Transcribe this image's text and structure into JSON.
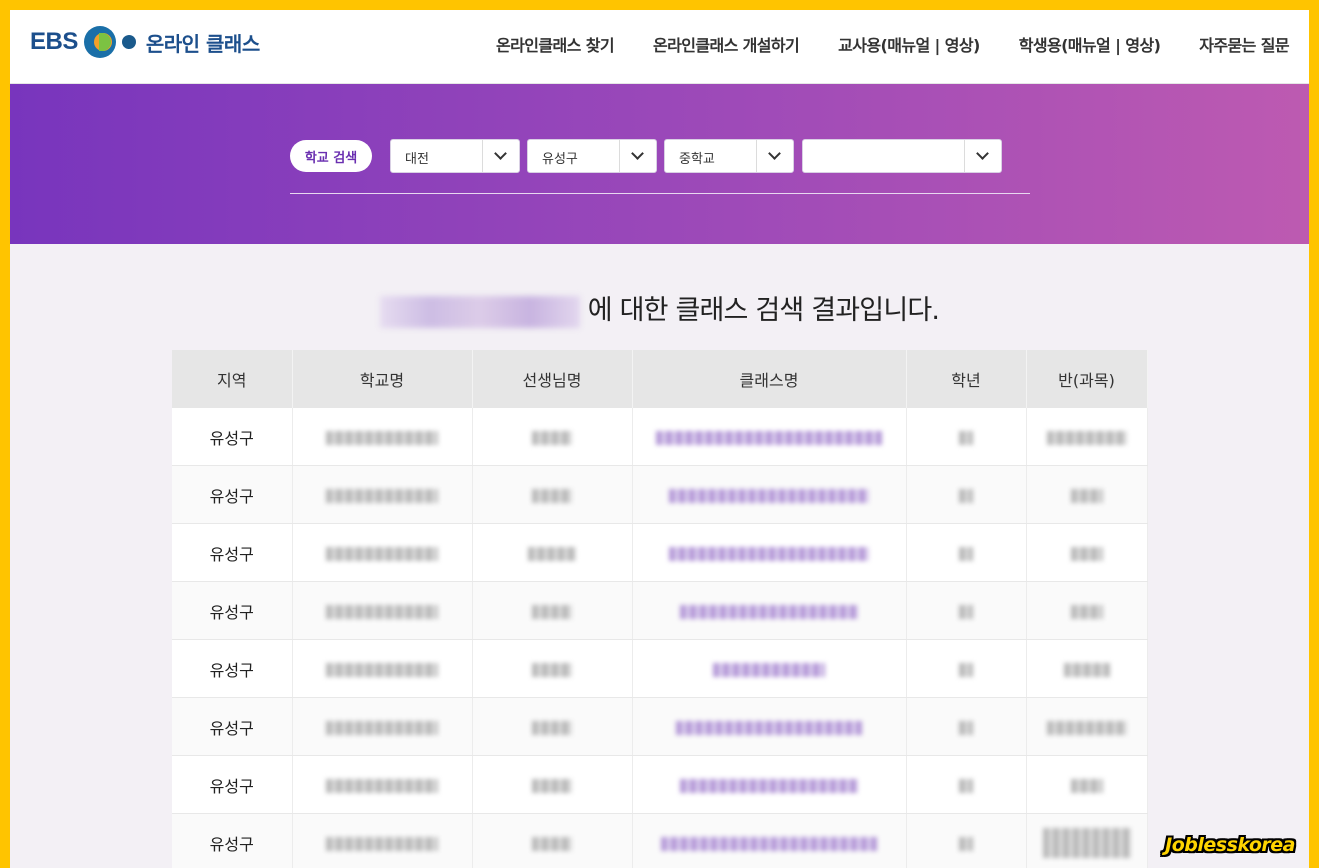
{
  "header": {
    "logo_brand": "EBS",
    "logo_text": "온라인 클래스",
    "nav": [
      "온라인클래스 찾기",
      "온라인클래스 개설하기",
      "교사용(매뉴얼 | 영상)",
      "학생용(매뉴얼 | 영상)",
      "자주묻는 질문"
    ]
  },
  "search": {
    "badge": "학교 검색",
    "region": "대전",
    "district": "유성구",
    "school_level": "중학교",
    "school_name": ""
  },
  "result": {
    "suffix": "에 대한 클래스 검색 결과입니다."
  },
  "table": {
    "headers": [
      "지역",
      "학교명",
      "선생님명",
      "클래스명",
      "학년",
      "반(과목)"
    ],
    "rows": [
      {
        "region": "유성구"
      },
      {
        "region": "유성구"
      },
      {
        "region": "유성구"
      },
      {
        "region": "유성구"
      },
      {
        "region": "유성구"
      },
      {
        "region": "유성구"
      },
      {
        "region": "유성구"
      },
      {
        "region": "유성구"
      }
    ]
  },
  "watermark": "Joblesskorea",
  "colors": {
    "frame": "#ffc400",
    "brand": "#1c4f8c",
    "banner_start": "#7835bd",
    "banner_end": "#bd5ab1",
    "accent": "#6a2fb0"
  }
}
